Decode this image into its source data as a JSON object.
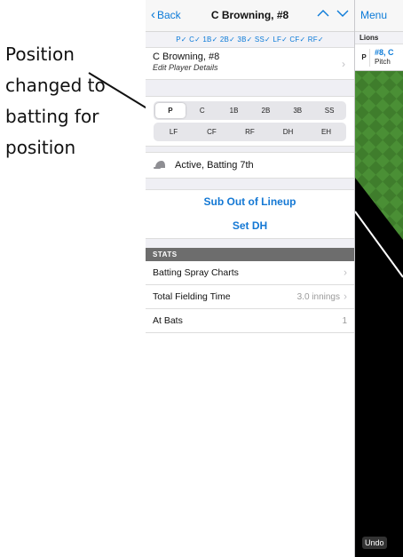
{
  "annotation": {
    "lines": [
      "Position",
      "changed to",
      "batting for",
      "position"
    ]
  },
  "nav": {
    "back_label": "Back",
    "title": "C Browning, #8"
  },
  "position_strip": "P✓ C✓ 1B✓ 2B✓ 3B✓ SS✓ LF✓ CF✓ RF✓",
  "player": {
    "name": "C Browning, #8",
    "subtitle": "Edit Player Details"
  },
  "positions": {
    "row1": [
      "P",
      "C",
      "1B",
      "2B",
      "3B",
      "SS"
    ],
    "row2": [
      "LF",
      "CF",
      "RF",
      "DH",
      "EH"
    ],
    "selected": "P"
  },
  "status": {
    "text": "Active, Batting 7th",
    "icon": "batting-helmet-icon"
  },
  "actions": {
    "sub_out": "Sub Out of Lineup",
    "set_dh": "Set DH"
  },
  "stats": {
    "header": "STATS",
    "rows": [
      {
        "label": "Batting Spray Charts",
        "value": ""
      },
      {
        "label": "Total Fielding Time",
        "value": "3.0 innings"
      },
      {
        "label": "At Bats",
        "value": "1"
      }
    ]
  },
  "right_panel": {
    "menu_label": "Menu",
    "team": "Lions",
    "player_pos": "P",
    "player_num": "#8, C",
    "player_role": "Pitch",
    "undo_label": "Undo"
  },
  "colors": {
    "accent": "#0a7ad8",
    "stats_header_bg": "#6d6d6d",
    "field_green": "#3f7d2c"
  }
}
